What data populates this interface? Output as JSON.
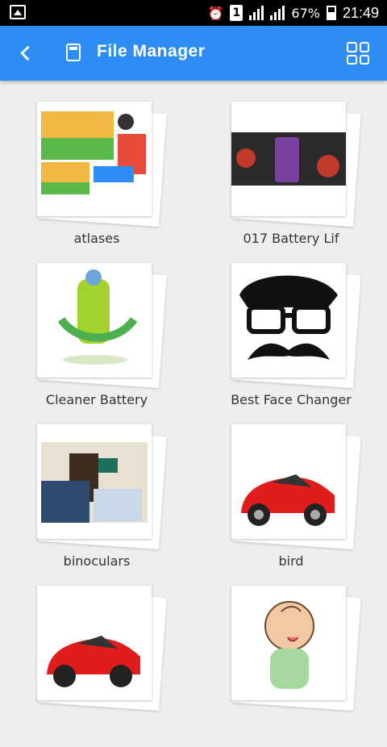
{
  "status_bar": {
    "battery": "67%",
    "time": "21:49",
    "sim_slot": "1"
  },
  "header": {
    "title": "File Manager"
  },
  "files": [
    {
      "name": "atlases"
    },
    {
      "name": "017 Battery Lif"
    },
    {
      "name": "Cleaner Battery"
    },
    {
      "name": "Best Face Changer"
    },
    {
      "name": "binoculars"
    },
    {
      "name": "bird"
    },
    {
      "name": ""
    },
    {
      "name": ""
    }
  ],
  "colors": {
    "accent": "#2d8df3",
    "background": "#eeeeee"
  }
}
